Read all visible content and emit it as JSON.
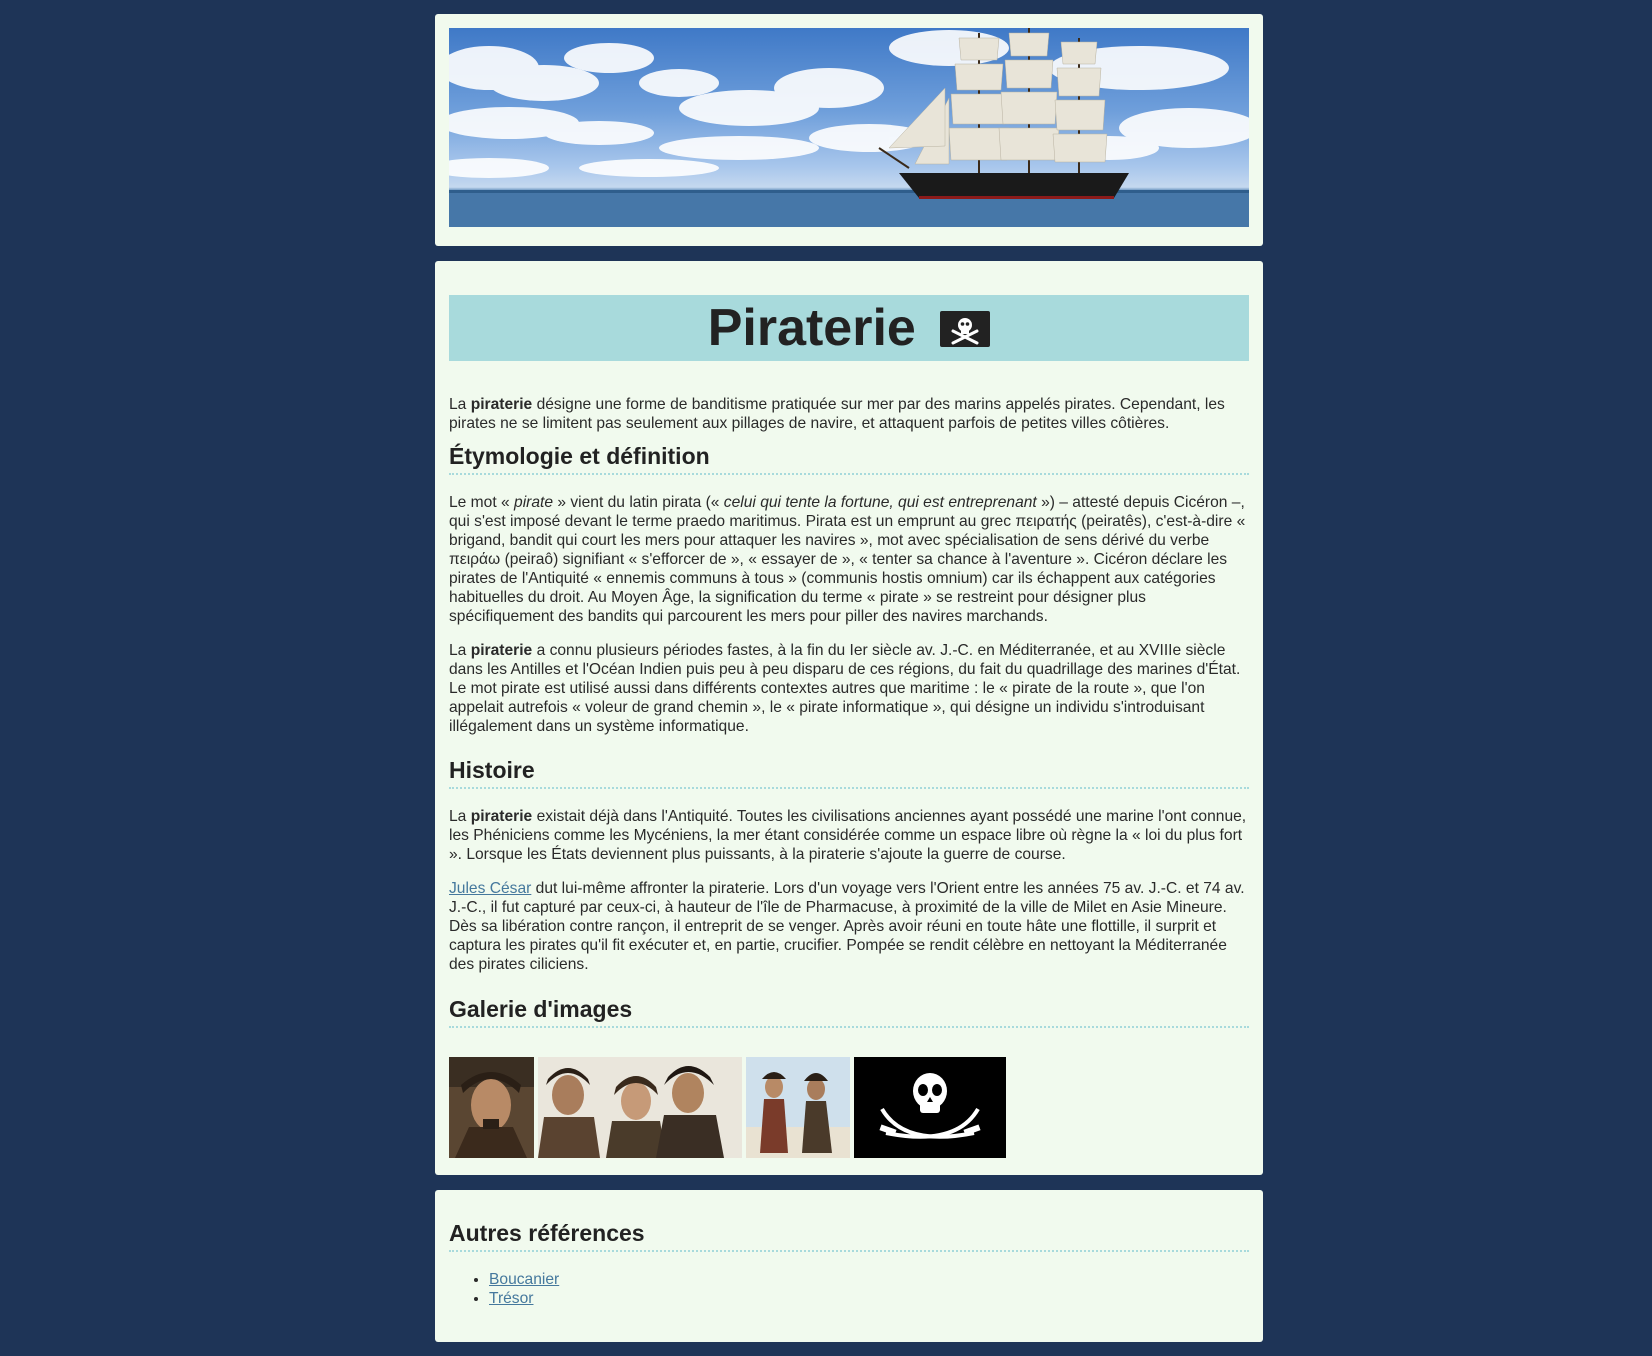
{
  "banner": {
    "image": "tall-ship-at-sea-banner"
  },
  "main": {
    "title": "Piraterie",
    "title_icon": "pirate-flag-icon",
    "intro": {
      "p1_a": "La ",
      "p1_b": "piraterie",
      "p1_c": " désigne une forme de banditisme pratiquée sur mer par des marins appelés pirates. Cependant, les pirates ne se limitent pas seulement aux pillages de navire, et attaquent parfois de petites villes côtières."
    },
    "etymology": {
      "heading": "Étymologie et définition",
      "p1_a": "Le mot « ",
      "p1_b": "pirate",
      "p1_c": " » vient du latin pirata (« ",
      "p1_d": "celui qui tente la fortune, qui est entreprenant",
      "p1_e": " ») – attesté depuis Cicéron –, qui s'est imposé devant le terme praedo maritimus. Pirata est un emprunt au grec πειρατής (peiratês), c'est-à-dire « brigand, bandit qui court les mers pour attaquer les navires », mot avec spécialisation de sens dérivé du verbe πειράω (peiraô) signifiant « s'efforcer de », « essayer de », « tenter sa chance à l'aventure ». Cicéron déclare les pirates de l'Antiquité « ennemis communs à tous » (communis hostis omnium) car ils échappent aux catégories habituelles du droit. Au Moyen Âge, la signification du terme « pirate » se restreint pour désigner plus spécifiquement des bandits qui parcourent les mers pour piller des navires marchands.",
      "p2_a": "La ",
      "p2_b": "piraterie",
      "p2_c": " a connu plusieurs périodes fastes, à la fin du Ier siècle av. J.-C. en Méditerranée, et au XVIIIe siècle dans les Antilles et l'Océan Indien puis peu à peu disparu de ces régions, du fait du quadrillage des marines d'État. Le mot pirate est utilisé aussi dans différents contextes autres que maritime : le « pirate de la route », que l'on appelait autrefois « voleur de grand chemin », le « pirate informatique », qui désigne un individu s'introduisant illégalement dans un système informatique."
    },
    "history": {
      "heading": "Histoire",
      "p1_a": "La ",
      "p1_b": "piraterie",
      "p1_c": " existait déjà dans l'Antiquité. Toutes les civilisations anciennes ayant possédé une marine l'ont connue, les Phéniciens comme les Mycéniens, la mer étant considérée comme un espace libre où règne la « loi du plus fort ». Lorsque les États deviennent plus puissants, à la piraterie s'ajoute la guerre de course.",
      "p2_link": "Jules César",
      "p2_rest": " dut lui-même affronter la piraterie. Lors d'un voyage vers l'Orient entre les années 75 av. J.-C. et 74 av. J.-C., il fut capturé par ceux-ci, à hauteur de l'île de Pharmacuse, à proximité de la ville de Milet en Asie Mineure. Dès sa libération contre rançon, il entreprit de se venger. Après avoir réuni en toute hâte une flottille, il surprit et captura les pirates qu'il fit exécuter et, en partie, crucifier. Pompée se rendit célèbre en nettoyant la Méditerranée des pirates ciliciens."
    },
    "gallery": {
      "heading": "Galerie d'images",
      "images": [
        "pirate-portrait-photo",
        "pirate-crew-photo",
        "pirates-on-beach-photo",
        "jolly-roger-flag-image"
      ]
    }
  },
  "refs": {
    "heading": "Autres références",
    "links": [
      "Boucanier",
      "Trésor"
    ]
  },
  "colors": {
    "page_background": "#1e3457",
    "card_background": "#f1faee",
    "title_bar": "#a8dadc",
    "link": "#45789d"
  }
}
